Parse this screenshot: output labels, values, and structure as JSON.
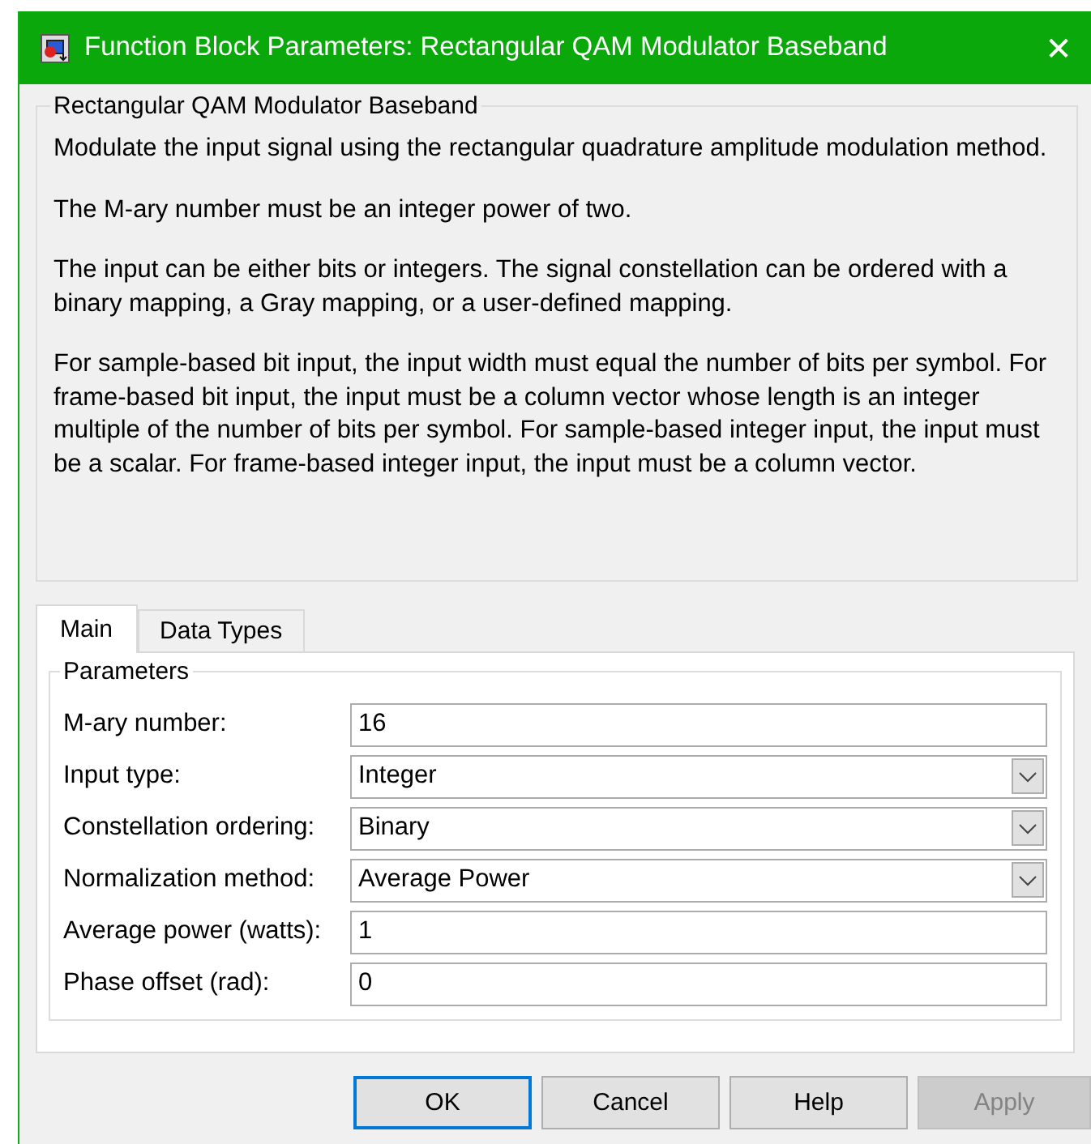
{
  "window": {
    "title": "Function Block Parameters: Rectangular QAM Modulator Baseband",
    "close": "✕"
  },
  "description": {
    "title": "Rectangular QAM Modulator Baseband",
    "paragraphs": [
      "Modulate the input signal using the rectangular quadrature amplitude modulation method.",
      "The M-ary number must be an integer power of two.",
      "The input can be either bits or integers. The signal constellation can be ordered with a binary mapping, a Gray mapping, or a user-defined mapping.",
      "For sample-based bit input, the input width must equal the number of bits per symbol. For frame-based bit input, the input must be a column vector whose length is an integer multiple of the number of bits per symbol. For sample-based integer input, the input must be a scalar. For frame-based integer input, the input must be a column vector."
    ]
  },
  "tabs": [
    {
      "label": "Main",
      "selected": true
    },
    {
      "label": "Data Types",
      "selected": false
    }
  ],
  "parameters": {
    "title": "Parameters",
    "fields": [
      {
        "label": "M-ary number:",
        "kind": "text",
        "value": "16"
      },
      {
        "label": "Input type:",
        "kind": "dropdown",
        "value": "Integer"
      },
      {
        "label": "Constellation ordering:",
        "kind": "dropdown",
        "value": "Binary"
      },
      {
        "label": "Normalization method:",
        "kind": "dropdown",
        "value": "Average Power"
      },
      {
        "label": "Average power (watts):",
        "kind": "text",
        "value": "1"
      },
      {
        "label": "Phase offset (rad):",
        "kind": "text",
        "value": "0"
      }
    ]
  },
  "buttons": [
    {
      "label": "OK",
      "default": true,
      "disabled": false
    },
    {
      "label": "Cancel",
      "default": false,
      "disabled": false
    },
    {
      "label": "Help",
      "default": false,
      "disabled": false
    },
    {
      "label": "Apply",
      "default": false,
      "disabled": true
    }
  ]
}
